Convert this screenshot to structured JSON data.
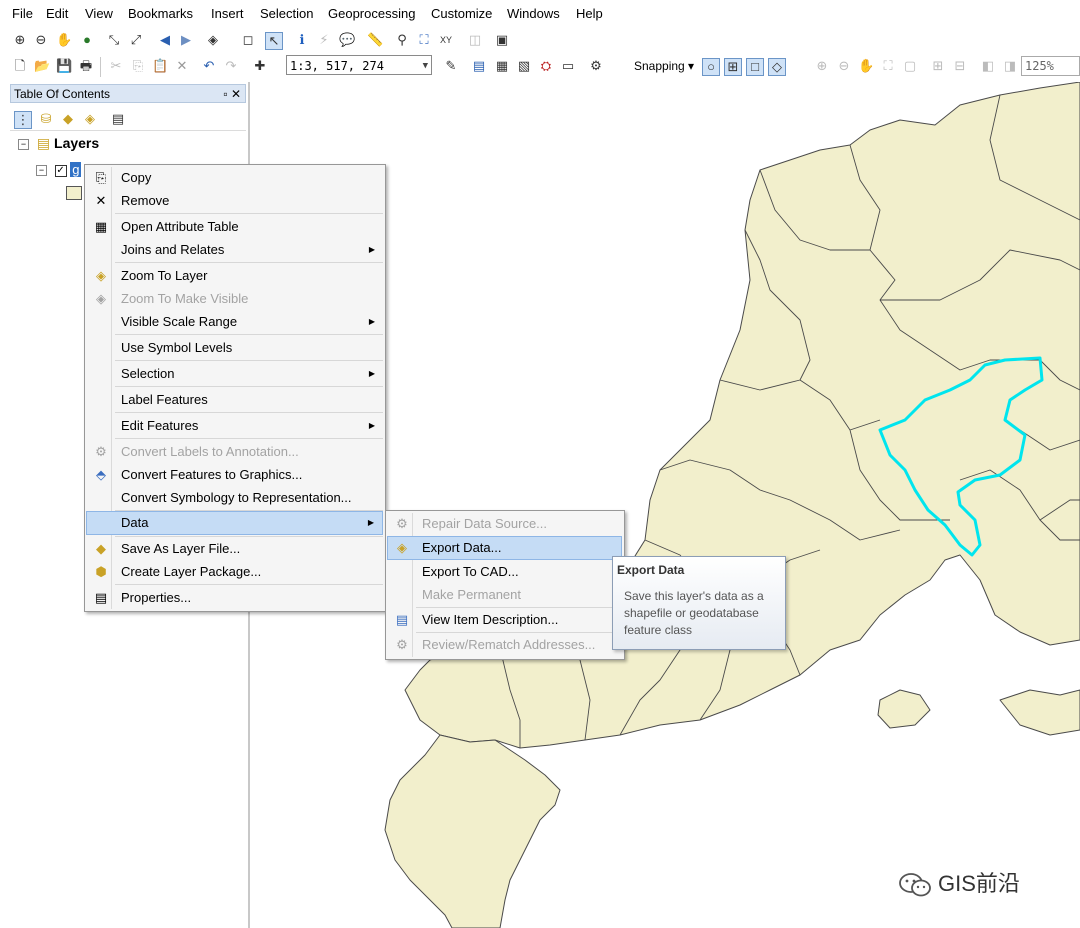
{
  "menubar": [
    "File",
    "Edit",
    "View",
    "Bookmarks",
    "Insert",
    "Selection",
    "Geoprocessing",
    "Customize",
    "Windows",
    "Help"
  ],
  "toolbar": {
    "scale": "1:3, 517, 274",
    "snapping_label": "Snapping",
    "zoom_percent": "125%"
  },
  "toc": {
    "title": "Table Of Contents",
    "root_label": "Layers",
    "layer_label": "g"
  },
  "context_menu": {
    "items": [
      {
        "label": "Copy",
        "icon": "copy-icon",
        "enabled": true
      },
      {
        "label": "Remove",
        "icon": "remove-icon",
        "enabled": true
      },
      {
        "label": "Open Attribute Table",
        "icon": "table-icon",
        "enabled": true
      },
      {
        "label": "Joins and Relates",
        "submenu": true,
        "enabled": true
      },
      {
        "label": "Zoom To Layer",
        "icon": "zoom-to-layer-icon",
        "enabled": true
      },
      {
        "label": "Zoom To Make Visible",
        "icon": "zoom-visible-icon",
        "enabled": false
      },
      {
        "label": "Visible Scale Range",
        "submenu": true,
        "enabled": true
      },
      {
        "label": "Use Symbol Levels",
        "enabled": true
      },
      {
        "label": "Selection",
        "submenu": true,
        "enabled": true
      },
      {
        "label": "Label Features",
        "enabled": true
      },
      {
        "label": "Edit Features",
        "submenu": true,
        "enabled": true
      },
      {
        "label": "Convert Labels to Annotation...",
        "icon": "annotation-icon",
        "enabled": false
      },
      {
        "label": "Convert Features to Graphics...",
        "icon": "graphics-icon",
        "enabled": true
      },
      {
        "label": "Convert Symbology to Representation...",
        "enabled": true
      },
      {
        "label": "Data",
        "submenu": true,
        "enabled": true,
        "highlighted": true
      },
      {
        "label": "Save As Layer File...",
        "icon": "layer-file-icon",
        "enabled": true
      },
      {
        "label": "Create Layer Package...",
        "icon": "package-icon",
        "enabled": true
      },
      {
        "label": "Properties...",
        "icon": "properties-icon",
        "enabled": true
      }
    ]
  },
  "data_submenu": {
    "items": [
      {
        "label": "Repair Data Source...",
        "enabled": false
      },
      {
        "label": "Export Data...",
        "enabled": true,
        "highlighted": true
      },
      {
        "label": "Export To CAD...",
        "enabled": true
      },
      {
        "label": "Make Permanent",
        "enabled": false
      },
      {
        "label": "View Item Description...",
        "enabled": true
      },
      {
        "label": "Review/Rematch Addresses...",
        "enabled": false
      }
    ]
  },
  "tooltip": {
    "title": "Export Data",
    "body": "Save this layer's data as a shapefile or geodatabase feature class"
  },
  "watermark": "GIS前沿",
  "colors": {
    "map_fill": "#f2efcc",
    "map_stroke": "#4a4a4a",
    "selection_outline": "#00e5ee",
    "menu_highlight": "#c5dcf5"
  }
}
